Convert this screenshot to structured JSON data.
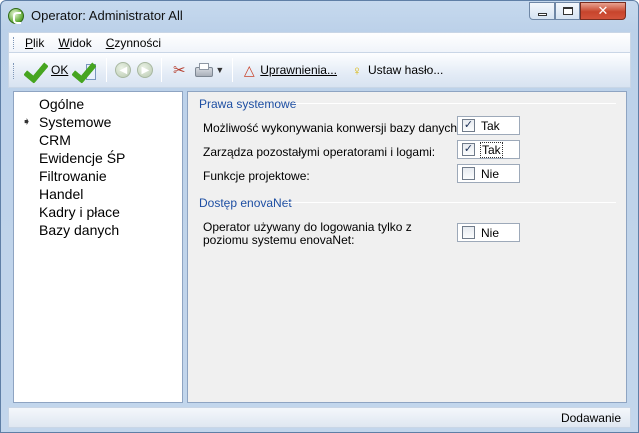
{
  "window": {
    "title": "Operator: Administrator All"
  },
  "menu": {
    "items": [
      {
        "label": "Plik"
      },
      {
        "label": "Widok"
      },
      {
        "label": "Czynności"
      }
    ]
  },
  "toolbar": {
    "ok_label": "OK",
    "permissions_label": "Uprawnienia...",
    "password_label": "Ustaw hasło...",
    "icons": [
      "check-icon",
      "check-doc-icon",
      "back-icon",
      "forward-icon",
      "tools-icon",
      "printer-icon",
      "warning-icon",
      "key-icon"
    ]
  },
  "sidebar": {
    "items": [
      {
        "label": "Ogólne"
      },
      {
        "label": "Systemowe",
        "selected": true
      },
      {
        "label": "CRM"
      },
      {
        "label": "Ewidencje ŚP"
      },
      {
        "label": "Filtrowanie"
      },
      {
        "label": "Handel"
      },
      {
        "label": "Kadry i płace"
      },
      {
        "label": "Bazy danych"
      }
    ]
  },
  "main": {
    "groups": [
      {
        "title": "Prawa systemowe",
        "fields": [
          {
            "label": "Możliwość wykonywania konwersji bazy danych:",
            "checked": true,
            "value": "Tak"
          },
          {
            "label": "Zarządza pozostałymi operatorami i logami:",
            "checked": true,
            "value": "Tak"
          },
          {
            "label": "Funkcje projektowe:",
            "checked": false,
            "value": "Nie"
          }
        ]
      },
      {
        "title": "Dostęp enovaNet",
        "fields": [
          {
            "label_line1": "Operator używany do logowania tylko z",
            "label_line2": "poziomu systemu enovaNet:",
            "checked": false,
            "value": "Nie"
          }
        ]
      }
    ]
  },
  "status": {
    "mode": "Dodawanie"
  }
}
